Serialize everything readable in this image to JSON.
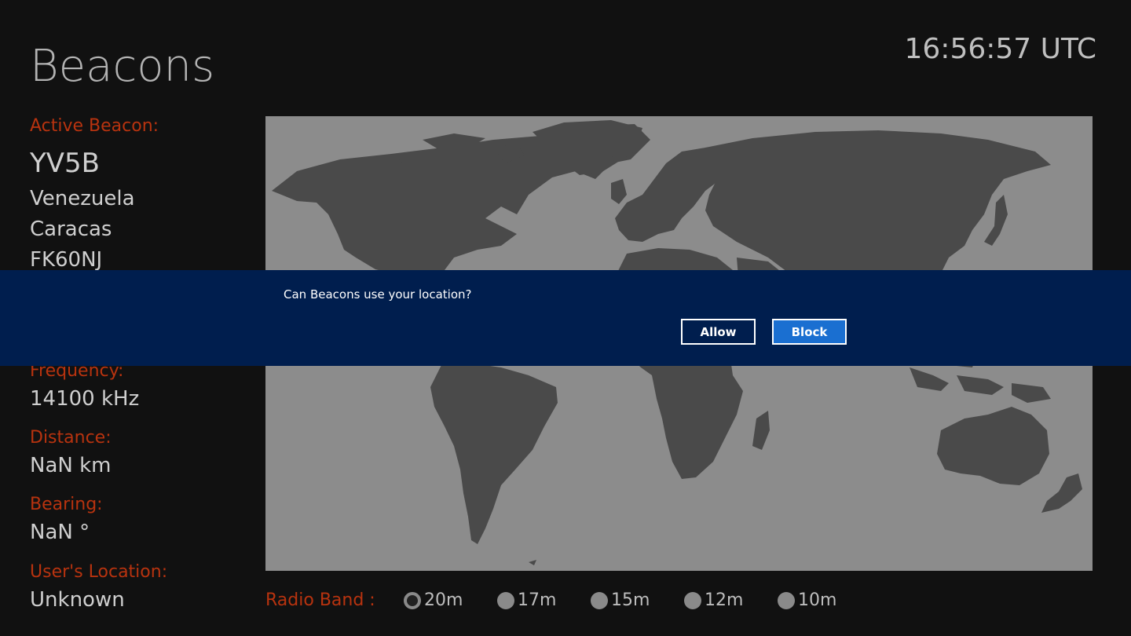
{
  "app": {
    "title": "Beacons",
    "clock": "16:56:57 UTC"
  },
  "beacon": {
    "active_label": "Active Beacon:",
    "callsign": "YV5B",
    "country": "Venezuela",
    "city": "Caracas",
    "grid": "FK60NJ",
    "frequency_label": "Frequency:",
    "frequency": "14100 kHz",
    "distance_label": "Distance:",
    "distance": "NaN km",
    "bearing_label": "Bearing:",
    "bearing": "NaN °",
    "user_location_label": "User's Location:",
    "user_location": "Unknown"
  },
  "band": {
    "label": "Radio Band :",
    "options": [
      {
        "label": "20m",
        "selected": true
      },
      {
        "label": "17m",
        "selected": false
      },
      {
        "label": "15m",
        "selected": false
      },
      {
        "label": "12m",
        "selected": false
      },
      {
        "label": "10m",
        "selected": false
      }
    ]
  },
  "dialog": {
    "prompt": "Can Beacons use your location?",
    "allow_label": "Allow",
    "block_label": "Block"
  },
  "colors": {
    "accent_label": "#b8330f",
    "dialog_bg": "#001e4e",
    "block_button": "#1a6fd1",
    "map_water": "#8c8c8c",
    "map_land": "#4a4a4a"
  }
}
